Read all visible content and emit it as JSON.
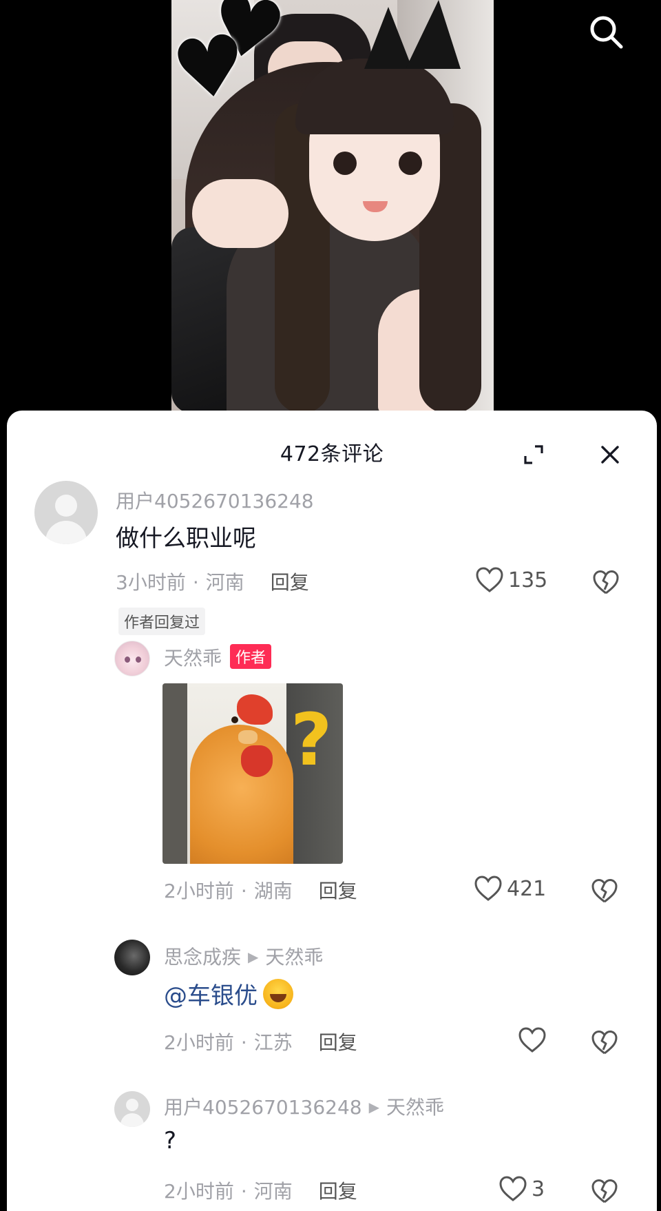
{
  "video": {
    "icon_search": "search-icon",
    "sticker_icon": "heart-sticker-icon"
  },
  "comments_panel": {
    "count_label": "472条评论",
    "expand_icon": "expand-icon",
    "close_icon": "close-icon"
  },
  "comments": [
    {
      "user": "用户4052670136248",
      "text": "做什么职业呢",
      "time": "3小时前",
      "location": "河南",
      "reply_label": "回复",
      "likes": "135",
      "author_replied_label": "作者回复过"
    }
  ],
  "replies": [
    {
      "user": "天然乖",
      "badge": "作者",
      "sticker_text": "?",
      "time": "2小时前",
      "location": "湖南",
      "reply_label": "回复",
      "likes": "421"
    },
    {
      "user": "思念成疾",
      "reply_to": "天然乖",
      "text": "@车银优",
      "time": "2小时前",
      "location": "江苏",
      "reply_label": "回复",
      "likes": ""
    },
    {
      "user": "用户4052670136248",
      "reply_to": "天然乖",
      "text": "?",
      "time": "2小时前",
      "location": "河南",
      "reply_label": "回复",
      "likes": "3"
    }
  ],
  "colors": {
    "author_badge": "#fe2c55",
    "mention": "#2b4d8c",
    "meta_gray": "#a0a1a7"
  }
}
